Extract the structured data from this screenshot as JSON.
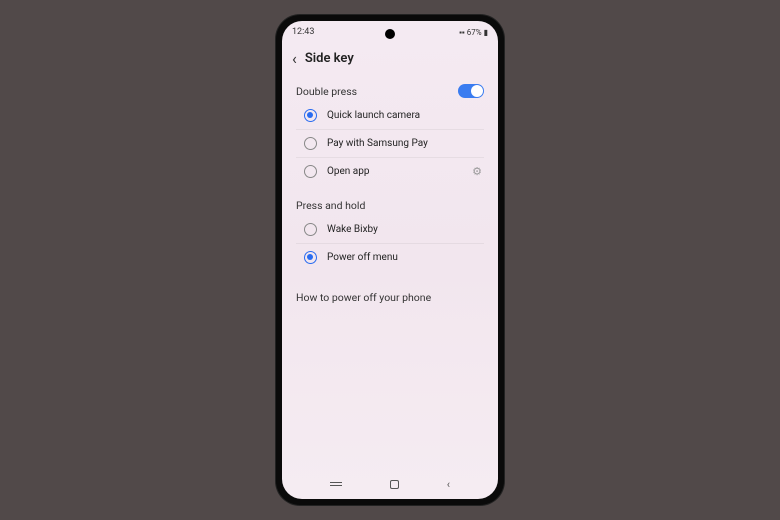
{
  "status": {
    "time": "12:43",
    "battery": "67%",
    "icons": "⚡ ⚫ 📶"
  },
  "header": {
    "title": "Side key"
  },
  "doublePress": {
    "title": "Double press",
    "enabled": true,
    "options": {
      "camera": "Quick launch camera",
      "samsungPay": "Pay with Samsung Pay",
      "openApp": "Open app"
    },
    "selected": "camera"
  },
  "pressHold": {
    "title": "Press and hold",
    "options": {
      "bixby": "Wake Bixby",
      "powerOff": "Power off menu"
    },
    "selected": "powerOff"
  },
  "link": {
    "howTo": "How to power off your phone"
  }
}
